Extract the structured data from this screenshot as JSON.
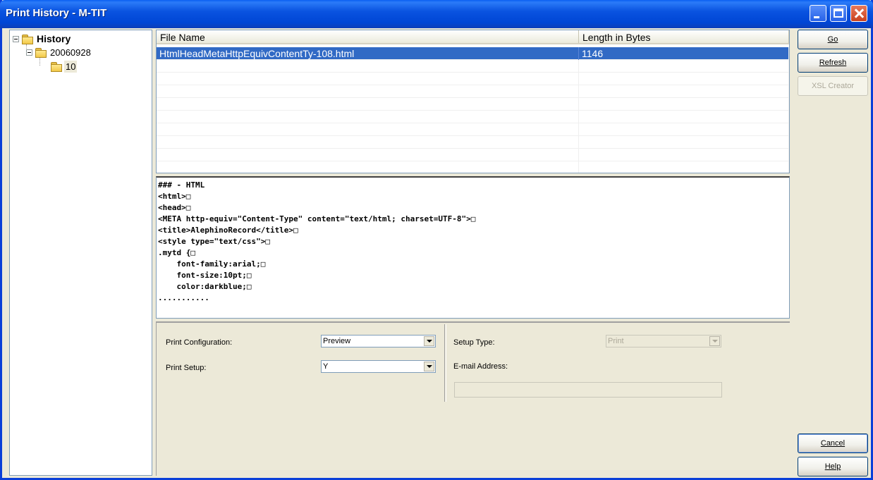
{
  "window": {
    "title": "Print History - M-TIT"
  },
  "tree": {
    "root": "History",
    "child": "20060928",
    "grandchild": "10"
  },
  "list": {
    "columns": [
      "File Name",
      "Length in Bytes"
    ],
    "rows": [
      {
        "file": "HtmlHeadMetaHttpEquivContentTy-108.html",
        "length": "1146"
      }
    ]
  },
  "preview": {
    "lines": [
      "### - HTML",
      "<html>□",
      "<head>□",
      "<META http-equiv=\"Content-Type\" content=\"text/html; charset=UTF-8\">□",
      "<title>AlephinoRecord</title>□",
      "<style type=\"text/css\">□",
      ".mytd {□",
      "    font-family:arial;□",
      "    font-size:10pt;□",
      "    color:darkblue;□",
      "..........."
    ]
  },
  "config": {
    "print_configuration_label": "Print Configuration:",
    "print_configuration_value": "Preview",
    "print_setup_label": "Print Setup:",
    "print_setup_value": "Y",
    "setup_type_label": "Setup Type:",
    "setup_type_value": "Print",
    "email_label": "E-mail Address:",
    "email_value": ""
  },
  "buttons": {
    "go": "Go",
    "refresh": "Refresh",
    "xsl_creator": "XSL Creator",
    "cancel": "Cancel",
    "help": "Help"
  }
}
